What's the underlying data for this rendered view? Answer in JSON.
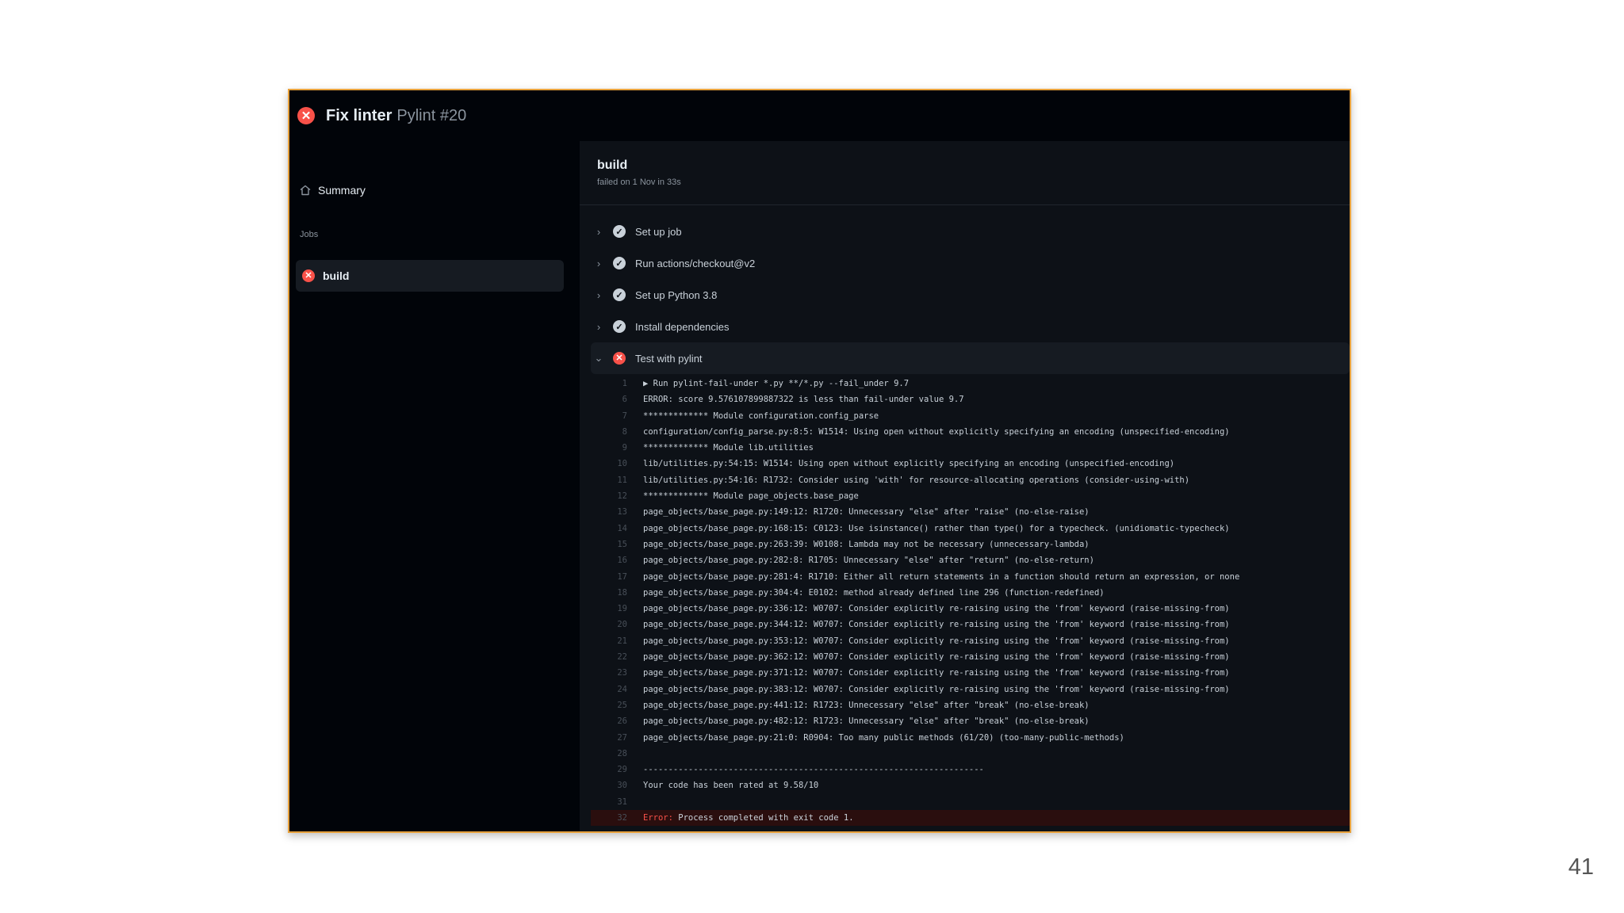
{
  "slide": {
    "page_number": "41"
  },
  "run": {
    "title": "Fix linter",
    "subtitle": "Pylint #20"
  },
  "sidebar": {
    "summary_label": "Summary",
    "jobs_heading": "Jobs",
    "jobs": [
      {
        "label": "build",
        "status": "failed"
      }
    ]
  },
  "job": {
    "name": "build",
    "meta": "failed on 1 Nov in 33s"
  },
  "steps": [
    {
      "label": "Set up job",
      "status": "success"
    },
    {
      "label": "Run actions/checkout@v2",
      "status": "success"
    },
    {
      "label": "Set up Python 3.8",
      "status": "success"
    },
    {
      "label": "Install dependencies",
      "status": "success"
    },
    {
      "label": "Test with pylint",
      "status": "failed",
      "expanded": true
    }
  ],
  "log": [
    {
      "n": "1",
      "t": "▶ Run pylint-fail-under *.py **/*.py --fail_under 9.7"
    },
    {
      "n": "6",
      "t": "ERROR: score 9.576107899887322 is less than fail-under value 9.7"
    },
    {
      "n": "7",
      "t": "************* Module configuration.config_parse"
    },
    {
      "n": "8",
      "t": "configuration/config_parse.py:8:5: W1514: Using open without explicitly specifying an encoding (unspecified-encoding)"
    },
    {
      "n": "9",
      "t": "************* Module lib.utilities"
    },
    {
      "n": "10",
      "t": "lib/utilities.py:54:15: W1514: Using open without explicitly specifying an encoding (unspecified-encoding)"
    },
    {
      "n": "11",
      "t": "lib/utilities.py:54:16: R1732: Consider using 'with' for resource-allocating operations (consider-using-with)"
    },
    {
      "n": "12",
      "t": "************* Module page_objects.base_page"
    },
    {
      "n": "13",
      "t": "page_objects/base_page.py:149:12: R1720: Unnecessary \"else\" after \"raise\" (no-else-raise)"
    },
    {
      "n": "14",
      "t": "page_objects/base_page.py:168:15: C0123: Use isinstance() rather than type() for a typecheck. (unidiomatic-typecheck)"
    },
    {
      "n": "15",
      "t": "page_objects/base_page.py:263:39: W0108: Lambda may not be necessary (unnecessary-lambda)"
    },
    {
      "n": "16",
      "t": "page_objects/base_page.py:282:8: R1705: Unnecessary \"else\" after \"return\" (no-else-return)"
    },
    {
      "n": "17",
      "t": "page_objects/base_page.py:281:4: R1710: Either all return statements in a function should return an expression, or none"
    },
    {
      "n": "18",
      "t": "page_objects/base_page.py:304:4: E0102: method already defined line 296 (function-redefined)"
    },
    {
      "n": "19",
      "t": "page_objects/base_page.py:336:12: W0707: Consider explicitly re-raising using the 'from' keyword (raise-missing-from)"
    },
    {
      "n": "20",
      "t": "page_objects/base_page.py:344:12: W0707: Consider explicitly re-raising using the 'from' keyword (raise-missing-from)"
    },
    {
      "n": "21",
      "t": "page_objects/base_page.py:353:12: W0707: Consider explicitly re-raising using the 'from' keyword (raise-missing-from)"
    },
    {
      "n": "22",
      "t": "page_objects/base_page.py:362:12: W0707: Consider explicitly re-raising using the 'from' keyword (raise-missing-from)"
    },
    {
      "n": "23",
      "t": "page_objects/base_page.py:371:12: W0707: Consider explicitly re-raising using the 'from' keyword (raise-missing-from)"
    },
    {
      "n": "24",
      "t": "page_objects/base_page.py:383:12: W0707: Consider explicitly re-raising using the 'from' keyword (raise-missing-from)"
    },
    {
      "n": "25",
      "t": "page_objects/base_page.py:441:12: R1723: Unnecessary \"else\" after \"break\" (no-else-break)"
    },
    {
      "n": "26",
      "t": "page_objects/base_page.py:482:12: R1723: Unnecessary \"else\" after \"break\" (no-else-break)"
    },
    {
      "n": "27",
      "t": "page_objects/base_page.py:21:0: R0904: Too many public methods (61/20) (too-many-public-methods)"
    },
    {
      "n": "28",
      "t": ""
    },
    {
      "n": "29",
      "t": "--------------------------------------------------------------------"
    },
    {
      "n": "30",
      "t": "Your code has been rated at 9.58/10"
    },
    {
      "n": "31",
      "t": ""
    },
    {
      "n": "32",
      "t": "Process completed with exit code 1.",
      "error_label": "Error:",
      "error": true
    }
  ],
  "colors": {
    "frame_border": "#e8a23d",
    "failure_red": "#f85149",
    "background_dark": "#0d1117"
  },
  "icons": {
    "run_status": "x-circle-icon",
    "summary": "home-icon",
    "step_success": "check-circle-icon",
    "step_collapsed": "chevron-right-icon",
    "step_expanded": "chevron-down-icon"
  }
}
